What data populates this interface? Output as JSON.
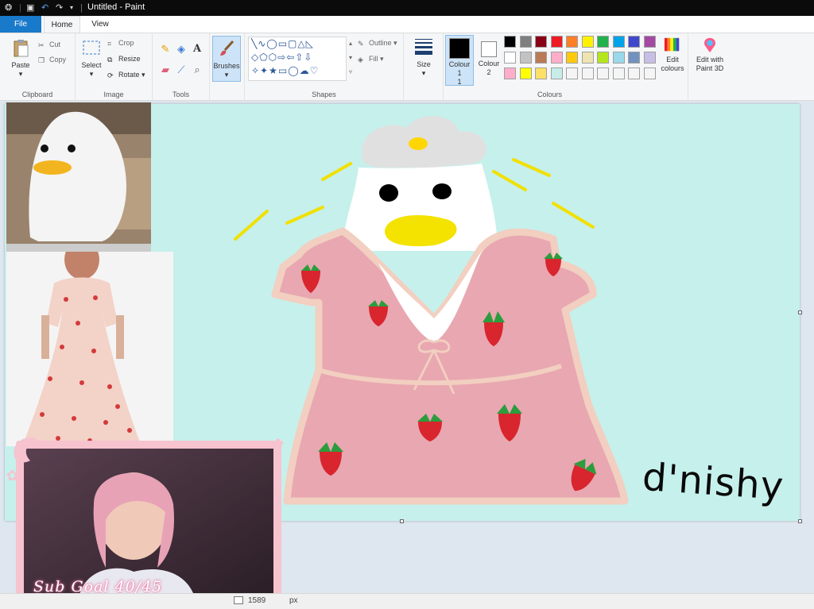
{
  "titlebar": {
    "title": "Untitled - Paint",
    "icons": [
      "paint-app-icon",
      "save-icon",
      "undo-icon",
      "redo-icon",
      "customize-icon"
    ]
  },
  "tabs": [
    {
      "label": "File",
      "active": false
    },
    {
      "label": "Home",
      "active": true
    },
    {
      "label": "View",
      "active": false
    }
  ],
  "ribbon": {
    "clipboard": {
      "label": "Clipboard",
      "paste": "Paste",
      "cut": "Cut",
      "copy": "Copy"
    },
    "image": {
      "label": "Image",
      "select": "Select",
      "crop": "Crop",
      "resize": "Resize",
      "rotate": "Rotate"
    },
    "tools": {
      "label": "Tools"
    },
    "brushes": {
      "label": "Brushes"
    },
    "shapes": {
      "label": "Shapes",
      "outline": "Outline",
      "fill": "Fill"
    },
    "size": {
      "label": "Size"
    },
    "colours": {
      "label": "Colours",
      "colour1": "Colour 1",
      "colour1_num": "1",
      "colour2": "Colour",
      "colour2_num": "2",
      "colour1_value": "#000000",
      "colour2_value": "#ffffff",
      "edit_colours": "Edit colours",
      "edit_paint3d": "Edit with Paint 3D",
      "palette_row1": [
        "#000000",
        "#7f7f7f",
        "#880015",
        "#ed1c24",
        "#ff7f27",
        "#fff200",
        "#22b14c",
        "#00a2e8",
        "#3f48cc",
        "#a349a4"
      ],
      "palette_row2": [
        "#ffffff",
        "#c3c3c3",
        "#b97a57",
        "#ffaec9",
        "#ffc90e",
        "#efe4b0",
        "#b5e61d",
        "#99d9ea",
        "#7092be",
        "#c8bfe7"
      ],
      "palette_row3": [
        "#ffaec9",
        "#ffff00",
        "#ffe066",
        "#c8ede8",
        "#f5f5f5",
        "#f5f5f5",
        "#f5f5f5",
        "#f5f5f5",
        "#f5f5f5",
        "#f5f5f5"
      ]
    }
  },
  "canvas": {
    "background": "#c6f0ec",
    "signature": "d'nishy"
  },
  "overlay": {
    "sub_goal": "Sub Goal 40/45"
  },
  "status": {
    "dimensions": "1589",
    "unit": "px"
  }
}
